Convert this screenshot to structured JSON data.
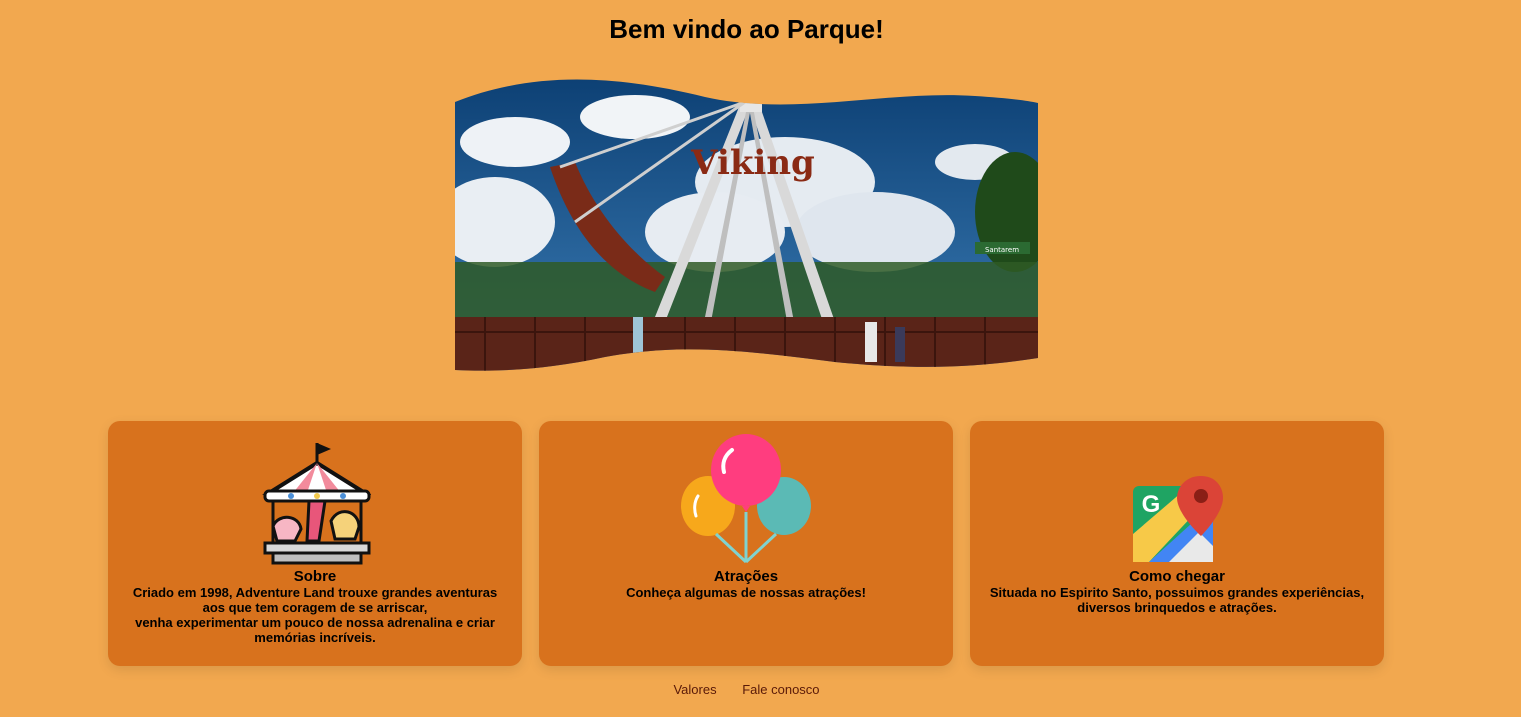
{
  "header": {
    "title": "Bem vindo ao Parque!"
  },
  "hero": {
    "sign_text": "Viking",
    "sub_sign": "Santarem"
  },
  "cards": [
    {
      "icon": "carousel-icon",
      "title": "Sobre",
      "text": "Criado em 1998, Adventure Land trouxe grandes aventuras aos que tem coragem de se arriscar,\nvenha experimentar um pouco de nossa adrenalina e criar memórias incríveis."
    },
    {
      "icon": "balloons-icon",
      "title": "Atrações",
      "text": "Conheça algumas de nossas atrações!"
    },
    {
      "icon": "google-maps-icon",
      "title": "Como chegar",
      "text": "Situada no Espirito Santo, possuimos grandes experiências, diversos brinquedos e atrações."
    }
  ],
  "footer": {
    "links": [
      "Valores",
      "Fale conosco"
    ]
  },
  "colors": {
    "background": "#f2a84f",
    "card": "#d8721d",
    "link": "#5a1a08"
  }
}
